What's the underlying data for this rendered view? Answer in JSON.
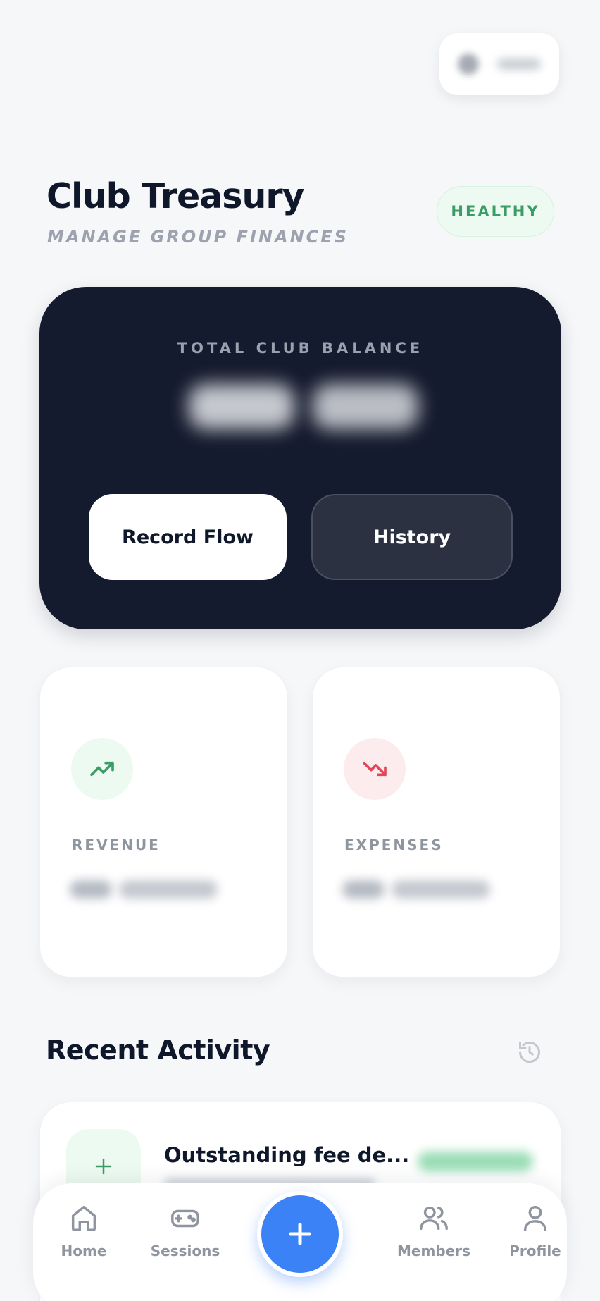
{
  "header": {
    "title": "Club Treasury",
    "subtitle": "MANAGE GROUP FINANCES",
    "status_badge": "HEALTHY"
  },
  "balance_card": {
    "label": "TOTAL CLUB BALANCE",
    "record_button": "Record Flow",
    "history_button": "History"
  },
  "stats": {
    "revenue": {
      "label": "REVENUE",
      "icon": "trending-up-icon",
      "color": "#3c9c66"
    },
    "expenses": {
      "label": "EXPENSES",
      "icon": "trending-down-icon",
      "color": "#e0485a"
    }
  },
  "recent_activity": {
    "title": "Recent Activity",
    "items": [
      {
        "title": "Outstanding fee de...",
        "icon": "plus-icon"
      }
    ]
  },
  "nav": {
    "items": [
      {
        "label": "Home",
        "icon": "home-icon"
      },
      {
        "label": "Sessions",
        "icon": "gamepad-icon"
      },
      {
        "label": "Members",
        "icon": "users-icon"
      },
      {
        "label": "Profile",
        "icon": "user-icon"
      }
    ],
    "fab_icon": "plus-icon"
  },
  "colors": {
    "accent": "#3b82f6",
    "card_dark": "#151b2e",
    "success": "#3c9c66",
    "danger": "#e0485a"
  }
}
